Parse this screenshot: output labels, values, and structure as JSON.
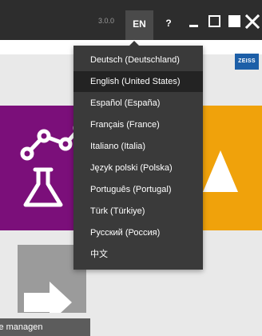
{
  "header": {
    "version": "3.0.0",
    "language_button": "EN",
    "help_label": "?"
  },
  "window_controls": [
    "minimize-icon",
    "restore-icon",
    "maximize-icon",
    "close-icon"
  ],
  "brand": {
    "logo_text": "ZEISS",
    "color": "#1d5fa8"
  },
  "tiles": {
    "left_label": "le managen",
    "colors": {
      "purple": "#7b0f7a",
      "orange": "#f0a20b",
      "gray": "#9b9b9b"
    }
  },
  "language_menu": {
    "selected": "English (United States)",
    "items": [
      "Deutsch (Deutschland)",
      "English (United States)",
      "Español (España)",
      "Français (France)",
      "Italiano (Italia)",
      "Język polski (Polska)",
      "Português (Portugal)",
      "Türk (Türkiye)",
      "Русский (Россия)",
      "中文"
    ]
  }
}
